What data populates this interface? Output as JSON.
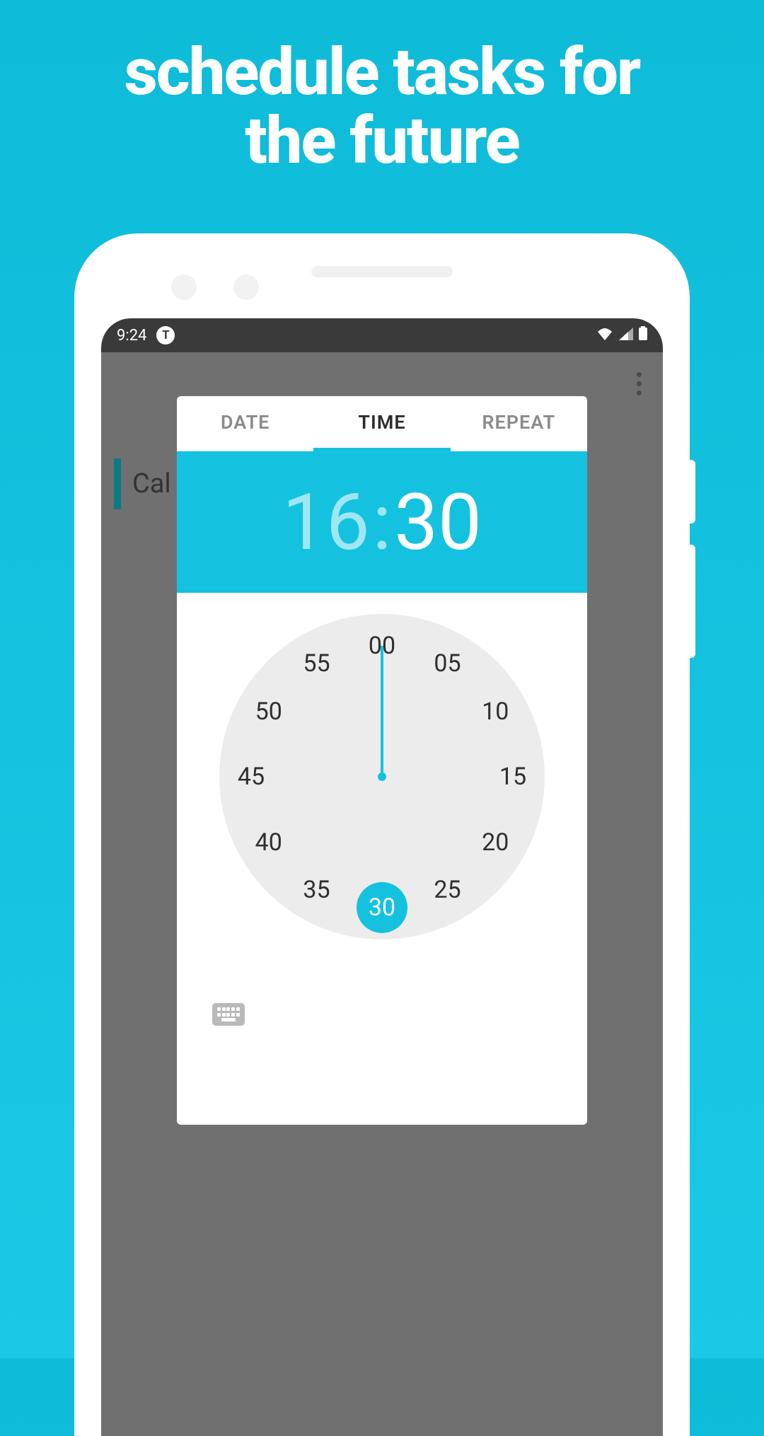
{
  "hero": {
    "line1": "schedule tasks for",
    "line2": "the future"
  },
  "statusbar": {
    "time": "9:24",
    "badge": "T"
  },
  "background": {
    "task_preview": "Cal"
  },
  "dialog": {
    "tabs": {
      "date": "DATE",
      "time": "TIME",
      "repeat": "REPEAT",
      "active": "time"
    },
    "time": {
      "hour": "16",
      "minute": "30"
    },
    "clock": {
      "mode": "minutes",
      "numbers": [
        "00",
        "05",
        "10",
        "15",
        "20",
        "25",
        "30",
        "35",
        "40",
        "45",
        "50",
        "55"
      ],
      "selected_index": 6,
      "selected_label": "30"
    }
  }
}
